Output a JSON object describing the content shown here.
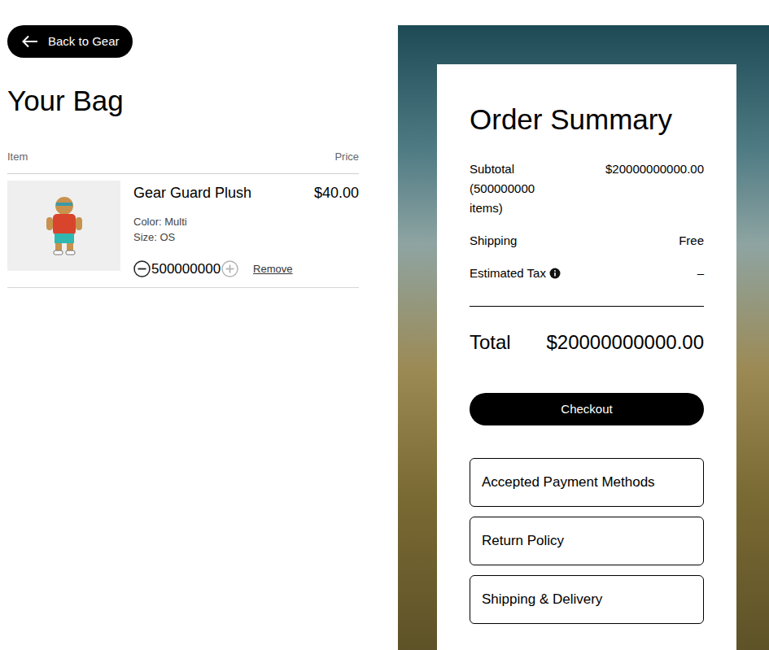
{
  "back_button": {
    "label": "Back to Gear"
  },
  "heading": "Your Bag",
  "table": {
    "columns": [
      "Item",
      "Price"
    ]
  },
  "items": [
    {
      "name": "Gear Guard Plush",
      "price": "$40.00",
      "details": [
        "Color: Multi",
        "Size: OS"
      ],
      "quantity": "500000000",
      "decrease_disabled": false,
      "increase_disabled": true,
      "remove": "Remove"
    }
  ],
  "summary": {
    "title": "Order Summary",
    "rows": [
      {
        "label": "Subtotal (500000000 items)",
        "value": "$20000000000.00",
        "info": false
      },
      {
        "label": "Shipping",
        "value": "Free",
        "info": false
      },
      {
        "label": "Estimated Tax",
        "value": "–",
        "info": true
      }
    ],
    "total": {
      "label": "Total",
      "value": "$20000000000.00"
    },
    "checkout": "Checkout",
    "links": [
      "Accepted Payment Methods",
      "Return Policy",
      "Shipping & Delivery"
    ]
  }
}
